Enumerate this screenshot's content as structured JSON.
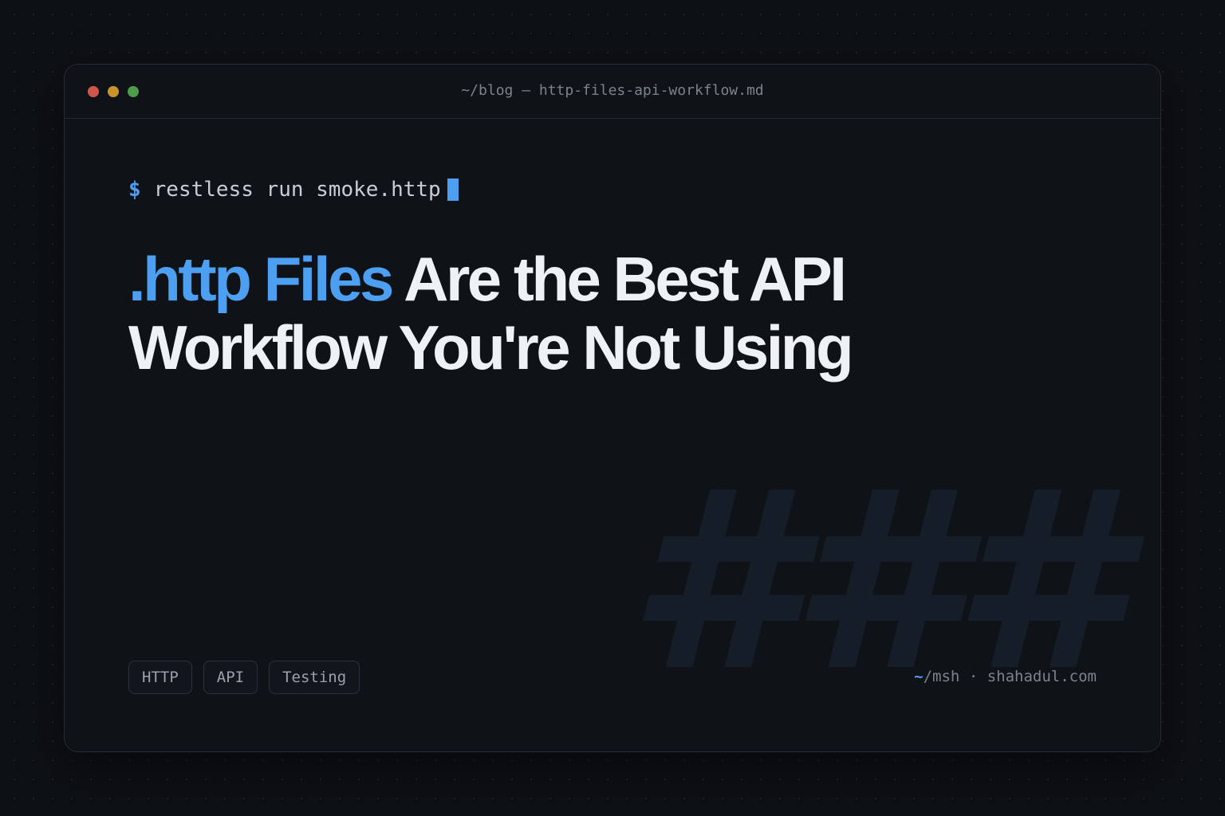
{
  "window": {
    "title": "~/blog — http-files-api-workflow.md",
    "controls": [
      {
        "name": "close",
        "color": "#d0564b"
      },
      {
        "name": "minimize",
        "color": "#c8952c"
      },
      {
        "name": "maximize",
        "color": "#4f9a4b"
      }
    ]
  },
  "prompt": {
    "symbol": "$",
    "command": "restless run smoke.http",
    "accent_color": "#4d9ff2"
  },
  "headline": {
    "highlight": ".http Files",
    "rest": "Are the Best API Workflow You're Not Using",
    "highlight_color": "#4d9ff2"
  },
  "watermark": "###",
  "tags": [
    "HTTP",
    "API",
    "Testing"
  ],
  "signature": {
    "tilde": "~",
    "handle": "/msh",
    "separator": "·",
    "site": "shahadul.com",
    "tilde_color": "#4d9ff2"
  }
}
